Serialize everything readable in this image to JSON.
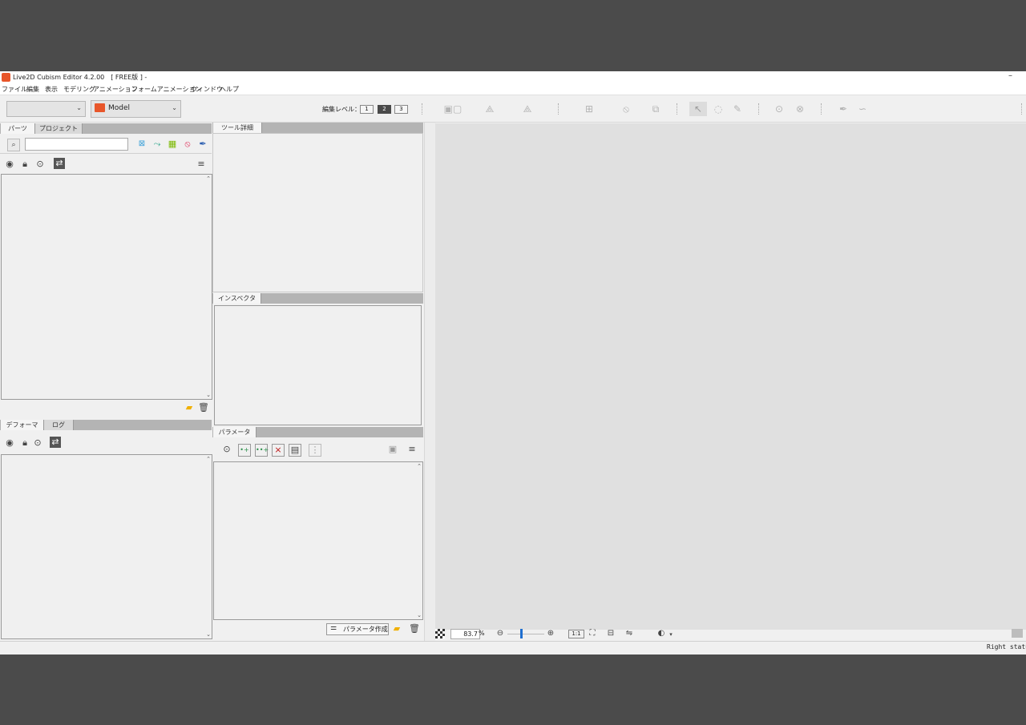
{
  "window": {
    "title": "Live2D Cubism Editor 4.2.00　[ FREE版 ] -",
    "minimize": "–"
  },
  "menu": [
    "ファイル",
    "編集",
    "表示",
    "モデリング",
    "アニメーション",
    "フォームアニメーション",
    "ウィンドウ",
    "ヘルプ"
  ],
  "toolbar": {
    "workspace_value": "",
    "model_value": "Model",
    "edit_level_label": "編集レベル：",
    "levels": [
      "1",
      "2",
      "3"
    ],
    "active_level": "2"
  },
  "parts_panel": {
    "tabs": [
      "パーツ",
      "プロジェクト"
    ],
    "search_placeholder": ""
  },
  "deformer_panel": {
    "tabs": [
      "デフォーマ",
      "ログ"
    ]
  },
  "tool_detail_panel": {
    "tab": "ツール詳細"
  },
  "inspector_panel": {
    "tab": "インスペクタ"
  },
  "parameter_panel": {
    "tab": "パラメータ",
    "create_button": "パラメータ作成"
  },
  "view": {
    "zoom_value": "83.7",
    "zoom_unit": "%",
    "one_to_one": "1:1"
  },
  "status": {
    "right_text": "Right status"
  },
  "colors": {
    "accent": "#e8562a",
    "canvas_bg": "#e0e0e0",
    "panel_bg": "#f0f0f0",
    "desktop_bg": "#4b4b4b"
  }
}
